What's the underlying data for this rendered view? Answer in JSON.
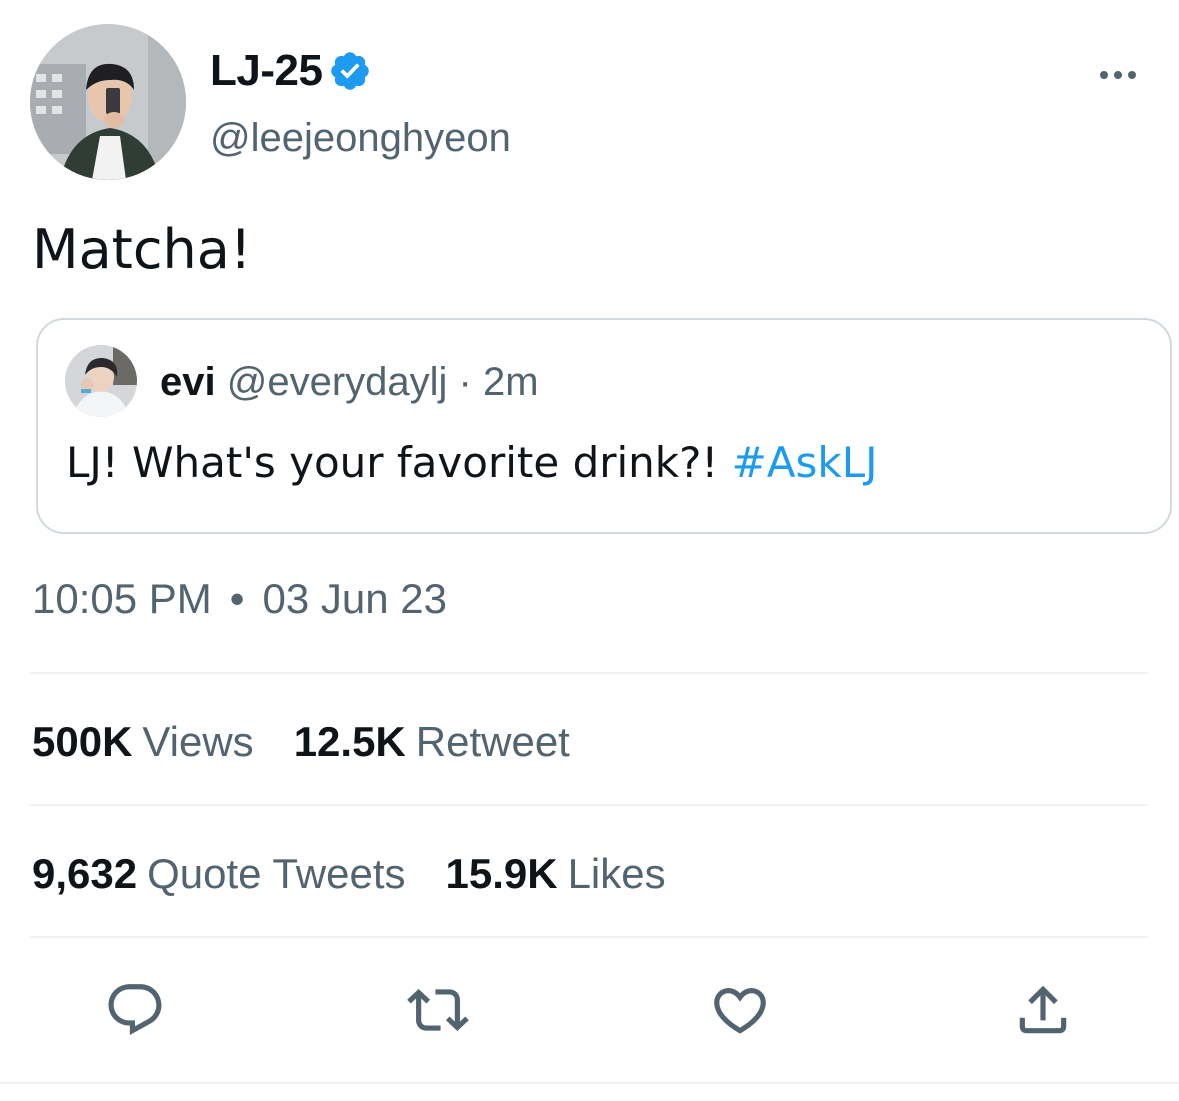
{
  "author": {
    "display_name": "LJ-25",
    "handle": "@leejeonghyeon",
    "verified": true,
    "avatar_icon": "profile-photo"
  },
  "tweet": {
    "text": "Matcha!",
    "time": "10:05 PM",
    "separator": "•",
    "date": "03 Jun 23"
  },
  "quoted": {
    "name": "evi",
    "handle_time": "@everydaylj · 2m",
    "text": "LJ! What's your favorite drink?! ",
    "hashtag": "#AskLJ"
  },
  "stats": {
    "views_value": "500K",
    "views_label": "Views",
    "retweets_value": "12.5K",
    "retweets_label": "Retweet",
    "quotes_value": "9,632",
    "quotes_label": "Quote Tweets",
    "likes_value": "15.9K",
    "likes_label": "Likes"
  },
  "actions": [
    "reply-icon",
    "retweet-icon",
    "like-icon",
    "share-icon"
  ],
  "colors": {
    "text": "#0f1419",
    "secondary": "#536471",
    "accent": "#1d9bf0",
    "border": "#cfd9de"
  }
}
